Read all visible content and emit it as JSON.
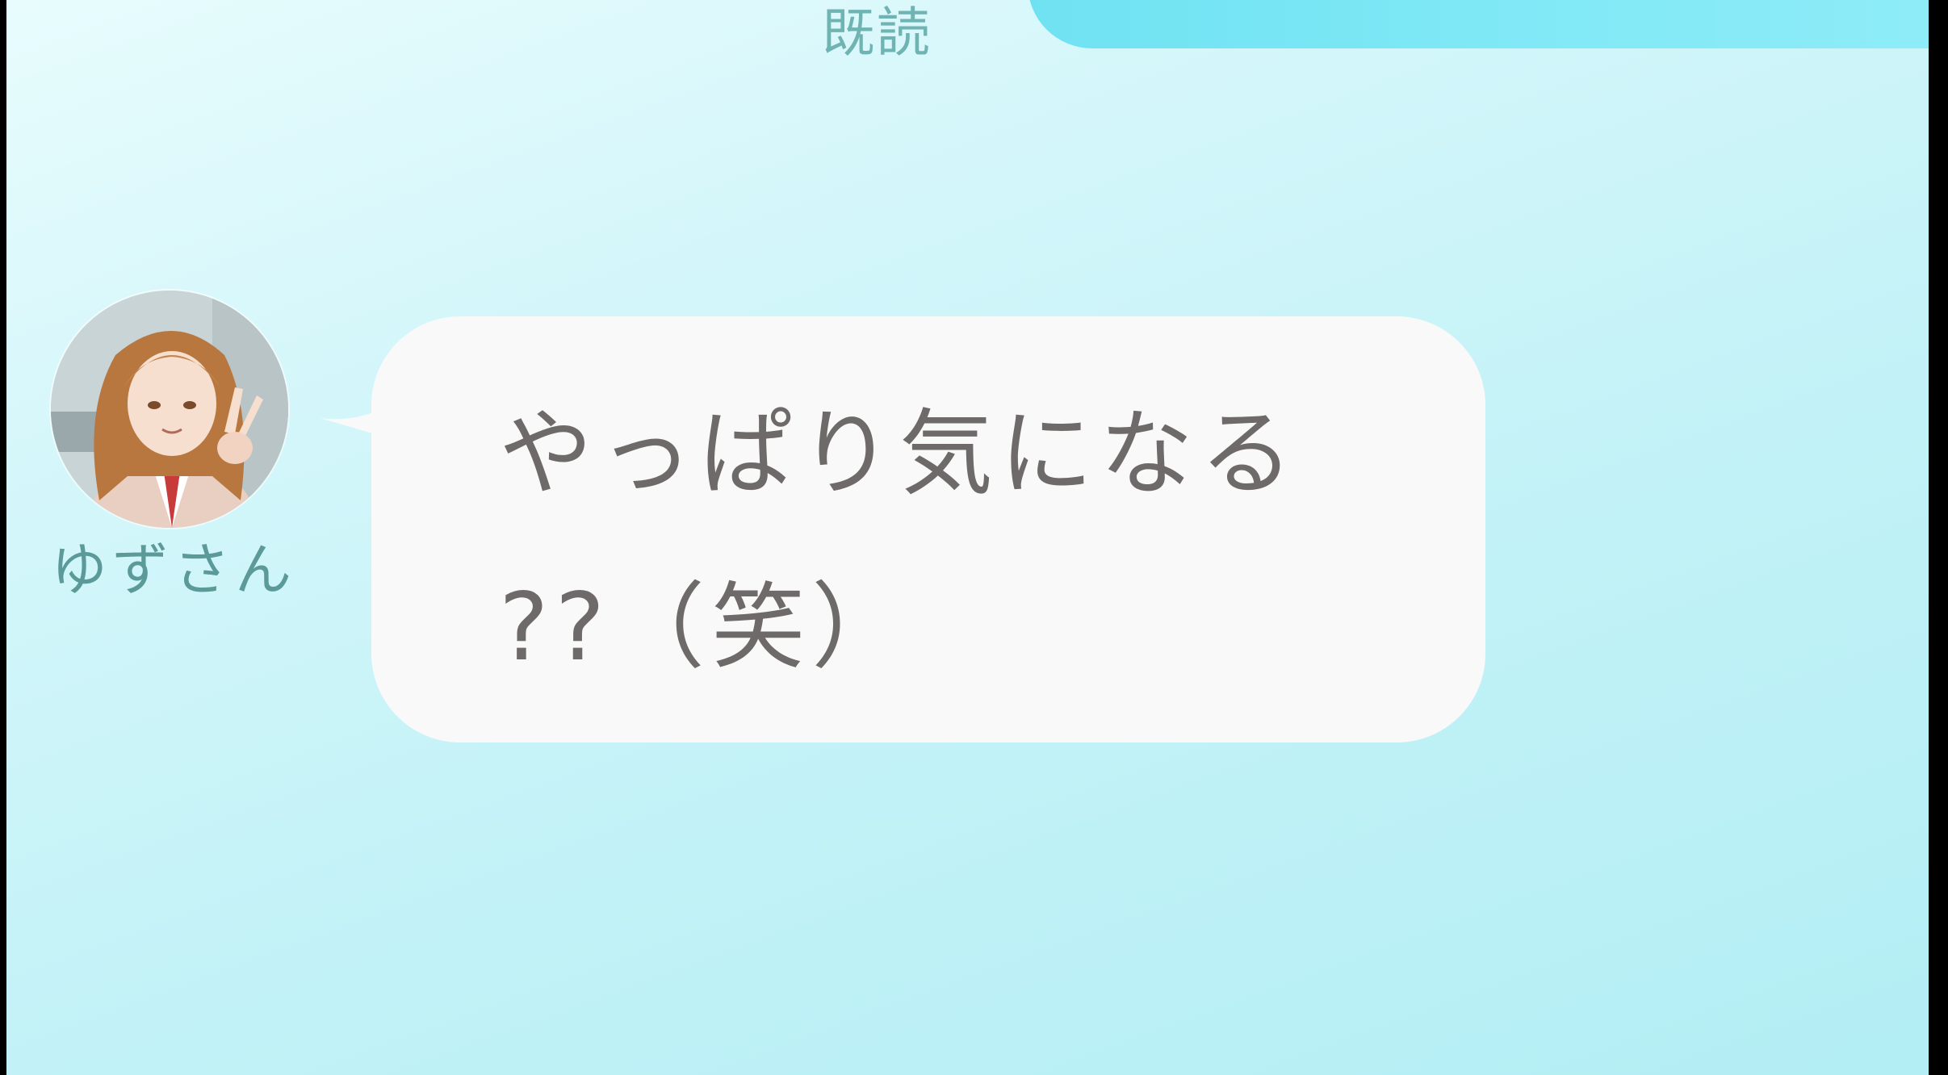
{
  "chat": {
    "read_receipt": "既読",
    "incoming_message": {
      "sender_name": "ゆずさん",
      "lines": [
        "やっぱり気になる",
        "??（笑）"
      ]
    }
  },
  "colors": {
    "background_top": "#e8fcfd",
    "background_bottom": "#b2eef4",
    "sent_bubble": "#7ee6f5",
    "incoming_bubble": "#f9f9f9",
    "message_text": "#6f6a6a",
    "name_text": "#5c9a9a",
    "read_receipt_text": "#6fb3b3"
  },
  "icons": {
    "avatar": "user-avatar-photo"
  }
}
